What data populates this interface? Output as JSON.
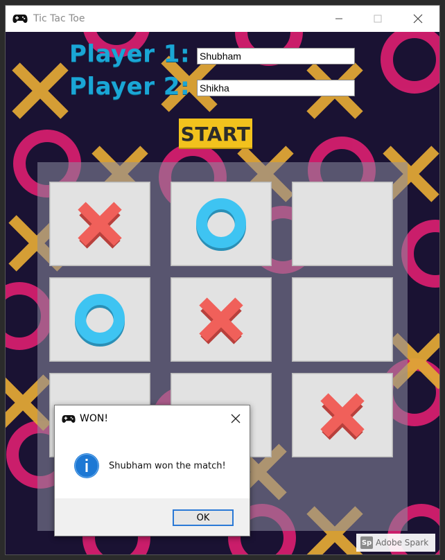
{
  "window": {
    "title": "Tic Tac Toe",
    "icon": "gamepad-icon",
    "controls": [
      "minimize-icon",
      "maximize-icon",
      "close-icon"
    ]
  },
  "players": {
    "player1_label": "Player 1:",
    "player1_value": "Shubham",
    "player2_label": "Player 2:",
    "player2_value": "Shikha"
  },
  "start_label": "START",
  "board": {
    "cells": [
      "X",
      "O",
      "",
      "O",
      "X",
      "",
      "",
      "",
      "X"
    ]
  },
  "dialog": {
    "title": "WON!",
    "icon": "info-icon",
    "message": "Shubham won the match!",
    "ok_label": "OK"
  },
  "watermark": {
    "badge": "Sp",
    "text": "Adobe Spark"
  },
  "colors": {
    "background": "#1a1233",
    "x_mark": "#f0605a",
    "o_mark": "#3ec4f2",
    "ring": "#d41f6e",
    "cross": "#e0a636",
    "label": "#1aa6d6",
    "start": "#f2c21d"
  }
}
